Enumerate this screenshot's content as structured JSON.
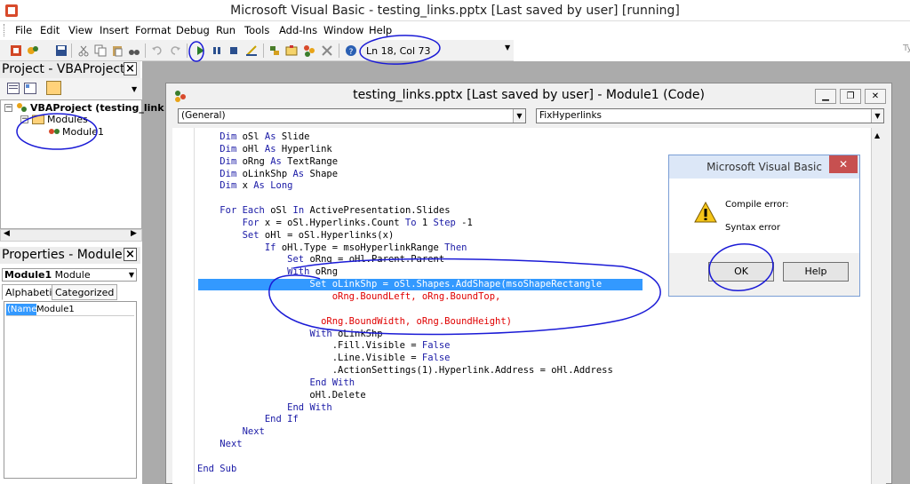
{
  "window": {
    "title": "Microsoft Visual Basic - testing_links.pptx [Last saved by user] [running]",
    "search_placeholder": "Ty"
  },
  "menu": [
    "File",
    "Edit",
    "View",
    "Insert",
    "Format",
    "Debug",
    "Run",
    "Tools",
    "Add-Ins",
    "Window",
    "Help"
  ],
  "toolbar": {
    "position": "Ln 18, Col 73"
  },
  "project": {
    "title": "Project - VBAProject",
    "root": "VBAProject (testing_link",
    "folder": "Modules",
    "module": "Module1"
  },
  "properties": {
    "title": "Properties - Module1",
    "object_name": "Module1",
    "object_type": "Module",
    "tabs": [
      "Alphabetic",
      "Categorized"
    ],
    "row_name": "(Name)",
    "row_value": "Module1"
  },
  "code_window": {
    "title": "testing_links.pptx [Last saved by user] - Module1 (Code)",
    "object_combo": "(General)",
    "proc_combo": "FixHyperlinks"
  },
  "code_lines": [
    "    Dim oSl As Slide",
    "    Dim oHl As Hyperlink",
    "    Dim oRng As TextRange",
    "    Dim oLinkShp As Shape",
    "    Dim x As Long",
    "",
    "    For Each oSl In ActivePresentation.Slides",
    "        For x = oSl.Hyperlinks.Count To 1 Step -1",
    "        Set oHl = oSl.Hyperlinks(x)",
    "            If oHl.Type = msoHyperlinkRange Then",
    "                Set oRng = oHl.Parent.Parent",
    "                With oRng",
    "                    Set oLinkShp = oSl.Shapes.AddShape(msoShapeRectangle",
    "                        oRng.BoundLeft, oRng.BoundTop,",
    "",
    "                      oRng.BoundWidth, oRng.BoundHeight)",
    "                    With oLinkShp",
    "                        .Fill.Visible = False",
    "                        .Line.Visible = False",
    "                        .ActionSettings(1).Hyperlink.Address = oHl.Address",
    "                    End With",
    "                    oHl.Delete",
    "                End With",
    "            End If",
    "        Next",
    "    Next",
    "",
    "End Sub"
  ],
  "dialog": {
    "title": "Microsoft Visual Basic",
    "line1": "Compile error:",
    "line2": "Syntax error",
    "ok": "OK",
    "help": "Help"
  },
  "colors": {
    "keyword": "#1a1aa6",
    "error": "#e00000",
    "selection": "#3399ff",
    "annotation": "#1a1ad6"
  }
}
